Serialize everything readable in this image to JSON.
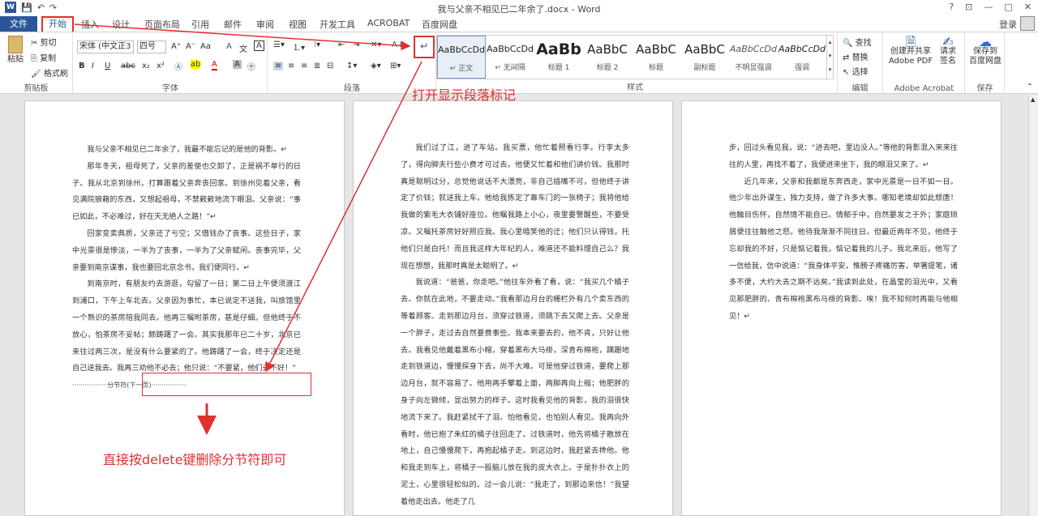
{
  "window": {
    "title": "我与父亲不相见已二年余了.docx - Word",
    "controls": [
      "?",
      "⊡",
      "—",
      "□",
      "✕"
    ]
  },
  "quick_access": {
    "save": "💾",
    "undo": "↶",
    "redo": "↷"
  },
  "tabs": {
    "file": "文件",
    "items": [
      "开始",
      "插入",
      "设计",
      "页面布局",
      "引用",
      "邮件",
      "审阅",
      "视图",
      "开发工具",
      "ACROBAT",
      "百度网盘"
    ],
    "login": "登录"
  },
  "ribbon": {
    "clipboard": {
      "label": "剪贴板",
      "paste": "粘贴",
      "cut": "剪切",
      "copy": "复制",
      "format_painter": "格式刷"
    },
    "font": {
      "label": "字体",
      "name": "宋体 (中文正3",
      "size": "四号",
      "bold": "B",
      "italic": "I",
      "underline": "U",
      "strike": "abc",
      "sub": "x₂",
      "sup": "x²",
      "grow": "A⁺",
      "shrink": "A⁻",
      "case": "Aa",
      "clear": "A",
      "phonetic": "文",
      "border": "A"
    },
    "paragraph": {
      "label": "段落",
      "show_marks": "↵",
      "sort": "A↓"
    },
    "styles": {
      "label": "样式",
      "items": [
        {
          "preview": "AaBbCcDd",
          "name": "↵ 正文"
        },
        {
          "preview": "AaBbCcDd",
          "name": "↵ 无间隔"
        },
        {
          "preview": "AaBb",
          "name": "标题 1"
        },
        {
          "preview": "AaBbC",
          "name": "标题 2"
        },
        {
          "preview": "AaBbC",
          "name": "标题"
        },
        {
          "preview": "AaBbC",
          "name": "副标题"
        },
        {
          "preview": "AaBbCcDd",
          "name": "不明显强调"
        },
        {
          "preview": "AaBbCcDd",
          "name": "强调"
        }
      ]
    },
    "editing": {
      "label": "编辑",
      "find": "查找",
      "replace": "替换",
      "select": "选择"
    },
    "acrobat": {
      "label": "Adobe Acrobat",
      "create": "创建并共享\nAdobe PDF",
      "request": "请求\n签名"
    },
    "save": {
      "label": "保存",
      "baidu": "保存到\n百度网盘"
    }
  },
  "annotations": {
    "open_marks": "打开显示段落标记",
    "delete_hint": "直接按delete键删除分节符即可"
  },
  "pages": [
    {
      "paragraphs": [
        "我与父亲不相见已二年余了，我最不能忘记的是他的背影。↵",
        "那年冬天，祖母死了，父亲的差使也交卸了，正是祸不单行的日子。我从北京到徐州，打算跟着父亲奔丧回家。到徐州见着父亲，看见满院狼藉的东西，又想起祖母，不禁簌簌地流下眼泪。父亲说：“事已如此，不必难过，好在天无绝人之路！”↵",
        "回家变卖典质，父亲还了亏空；又借钱办了丧事。这些日子，家中光景很是惨淡，一半为了丧事，一半为了父亲赋闲。丧事完毕，父亲要到南京谋事，我也要回北京念书，我们便同行。↵",
        "到南京时，有朋友约去游逛，勾留了一日；第二日上午便须渡江到浦口，下午上车北去。父亲因为事忙，本已说定不送我，叫旅馆里一个熟识的茶房陪我同去。他再三嘱咐茶房，甚是仔细。但他终于不放心，怕茶房不妥帖；颇踌躇了一会。其实我那年已二十岁，北京已来往过两三次，是没有什么要紧的了。他踌躇了一会，终于决定还是自己送我去。我再三劝他不必去；他只说：“不要紧，他们去不好！”"
      ],
      "section_break": "·················分节符(下一页)·················"
    },
    {
      "paragraphs": [
        "我们过了江，进了车站。我买票，他忙着照看行李。行李太多了，得向脚夫行些小费才可过去。他便又忙着和他们讲价钱。我那时真是聪明过分，总觉他说话不大漂亮，非自己插嘴不可，但他终于讲定了价钱；就送我上车。他给我拣定了靠车门的一张椅子；我将他给我做的紫毛大衣铺好座位。他嘱我路上小心，夜里要警醒些，不要受凉。又嘱托茶房好好照应我。我心里暗笑他的迂；他们只认得钱，托他们只是白托！而且我这样大年纪的人，难道还不能料理自己么？我现在想想，我那时真是太聪明了。↵",
        "我说道：“爸爸，你走吧。”他往车外看了看，说：“我买几个橘子去。你就在此地，不要走动。”我看那边月台的栅栏外有几个卖东西的等着顾客。走到那边月台，须穿过铁道，须跳下去又爬上去。父亲是一个胖子，走过去自然要费事些。我本来要去的，他不肯，只好让他去。我看见他戴着黑布小帽，穿着黑布大马褂，深青布棉袍，蹒跚地走到铁道边，慢慢探身下去，尚不大难。可是他穿过铁道，要爬上那边月台，就不容易了。他用两手攀着上面，两脚再向上缩；他肥胖的身子向左微倾，显出努力的样子。这时我看见他的背影，我的泪很快地流下来了。我赶紧拭干了泪。怕他看见，也怕别人看见。我再向外看时，他已抱了朱红的橘子往回走了。过铁道时，他先将橘子散放在地上，自己慢慢爬下，再抱起橘子走。到这边时，我赶紧去搀他。他和我走到车上，将橘子一股脑儿放在我的皮大衣上。于是扑扑衣上的泥土，心里很轻松似的。过一会儿说：“我走了，到那边来信！”我望着他走出去。他走了几"
      ]
    },
    {
      "paragraphs": [
        "步，回过头看见我，说：“进去吧，里边没人。”等他的背影混入来来往往的人里，再找不着了，我便进来坐下，我的眼泪又来了。↵",
        "近几年来，父亲和我都是东奔西走，家中光景是一日不如一日。他少年出外谋生，独力支持，做了许多大事。哪知老境却如此颓唐！他触目伤怀，自然情不能自已。情郁于中，自然要发之于外；家庭琐屑便往往触他之怒。他待我渐渐不同往日。但最近两年不见，他终于忘却我的不好，只是惦记着我，惦记着我的儿子。我北来后，他写了一信给我，信中说道：“我身体平安，惟膀子疼痛厉害，举箸提笔，诸多不便，大约大去之期不远矣。”我读到此处，在晶莹的泪光中，又看见那肥胖的、青布棉袍黑布马褂的背影。唉！我不知何时再能与他相见！↵"
      ]
    }
  ]
}
